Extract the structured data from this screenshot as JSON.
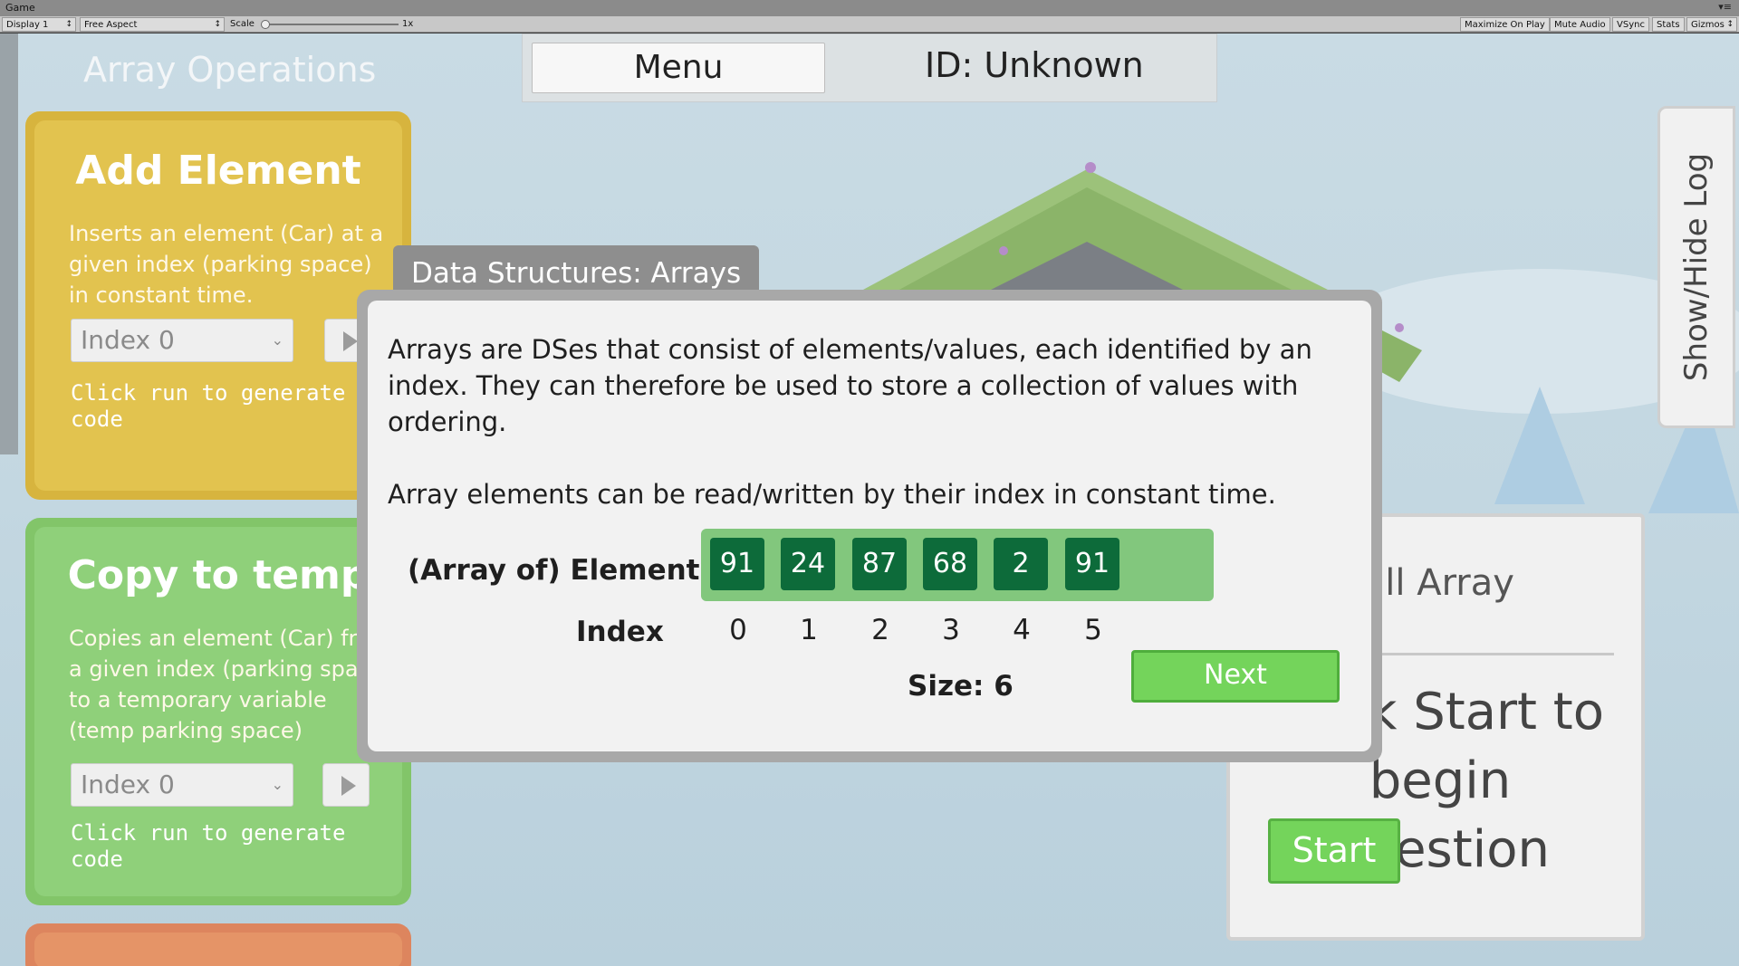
{
  "editor": {
    "tab_title": "Game",
    "window_controls": "▾≡",
    "display": "Display 1",
    "aspect": "Free Aspect",
    "scale_label": "Scale",
    "scale_value": "1x",
    "buttons": [
      "Maximize On Play",
      "Mute Audio",
      "VSync",
      "Stats",
      "Gizmos"
    ]
  },
  "page_title": "Array Operations",
  "topbar": {
    "menu_label": "Menu",
    "id_label": "ID: Unknown"
  },
  "log_toggle": "Show/Hide Log",
  "cards": {
    "add": {
      "title": "Add Element",
      "description": "Inserts an element (Car) at a given index (parking space) in constant time.",
      "select_value": "Index 0",
      "hint": "Click run to generate code"
    },
    "copy": {
      "title": "Copy to temp",
      "description": "Copies an element (Car) from a given index (parking space) to a temporary variable (temp parking space)",
      "select_value": "Index 0",
      "hint": "Click run to generate code"
    }
  },
  "question_panel": {
    "title": "Fill Array",
    "text": "Click Start to begin question",
    "start_label": "Start"
  },
  "modal": {
    "tab_title": "Data Structures: Arrays",
    "paragraph1": "Arrays are DSes that consist of elements/values, each identified by an index. They can therefore be used to store a collection of values with ordering.",
    "paragraph2": "Array elements can be read/written by their index in constant time.",
    "elements_label": "(Array of) Elements",
    "index_label": "Index",
    "elements": [
      "91",
      "24",
      "87",
      "68",
      "2",
      "91"
    ],
    "indices": [
      "0",
      "1",
      "2",
      "3",
      "4",
      "5"
    ],
    "size_label": "Size: 6",
    "next_label": "Next"
  },
  "colors": {
    "cell_bg": "#0d6b3a",
    "array_box": "#82c77d",
    "button_green": "#74d45b",
    "card_yellow": "#e2c34f",
    "card_green": "#8fd07a",
    "card_orange": "#e59467"
  }
}
